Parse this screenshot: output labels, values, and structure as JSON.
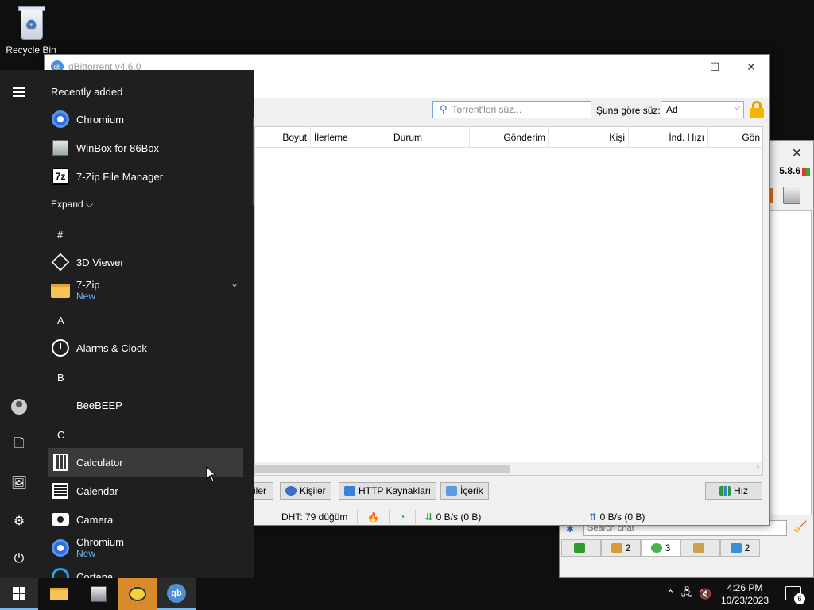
{
  "desktop": {
    "recycle_bin": "Recycle Bin"
  },
  "qbittorrent": {
    "title": "qBittorrent v4.6.0",
    "filter_placeholder": "Torrent'leri süz...",
    "sort_label": "Şuna göre süz:",
    "sort_value": "Ad",
    "columns": [
      "Boyut",
      "İlerleme",
      "Durum",
      "Gönderim",
      "Kişi",
      "İnd. Hızı",
      "Gön"
    ],
    "bottom_tabs": [
      "iler",
      "Kişiler",
      "HTTP Kaynakları",
      "İçerik",
      "Hız"
    ],
    "status": {
      "dht": "DHT: 79 düğüm",
      "download": "0 B/s (0 B)",
      "upload": "0 B/s (0 B)"
    }
  },
  "beebeep": {
    "version": "5.8.6",
    "search_placeholder": "Search chat",
    "tabs": [
      {
        "icon": "chat-list-icon",
        "count": ""
      },
      {
        "icon": "users-icon",
        "count": "2"
      },
      {
        "icon": "chats-icon",
        "count": "3"
      },
      {
        "icon": "groups-icon",
        "count": ""
      },
      {
        "icon": "files-icon",
        "count": "2"
      }
    ]
  },
  "start_menu": {
    "recently_added": "Recently added",
    "expand": "Expand",
    "recent": [
      {
        "name": "Chromium",
        "icon": "chromium-icon"
      },
      {
        "name": "WinBox for 86Box",
        "icon": "winbox-icon"
      },
      {
        "name": "7-Zip File Manager",
        "icon": "7zip-icon"
      }
    ],
    "groups": {
      "hash": "#",
      "a": "A",
      "b": "B",
      "c": "C"
    },
    "apps": {
      "viewer3d": "3D Viewer",
      "sevenzip": "7-Zip",
      "sevenzip_sub": "New",
      "alarms": "Alarms & Clock",
      "beebeep": "BeeBEEP",
      "calculator": "Calculator",
      "calendar": "Calendar",
      "camera": "Camera",
      "chromium": "Chromium",
      "chromium_sub": "New",
      "cortana": "Cortana"
    }
  },
  "taskbar": {
    "time": "4:26 PM",
    "date": "10/23/2023",
    "notification_count": "6"
  }
}
